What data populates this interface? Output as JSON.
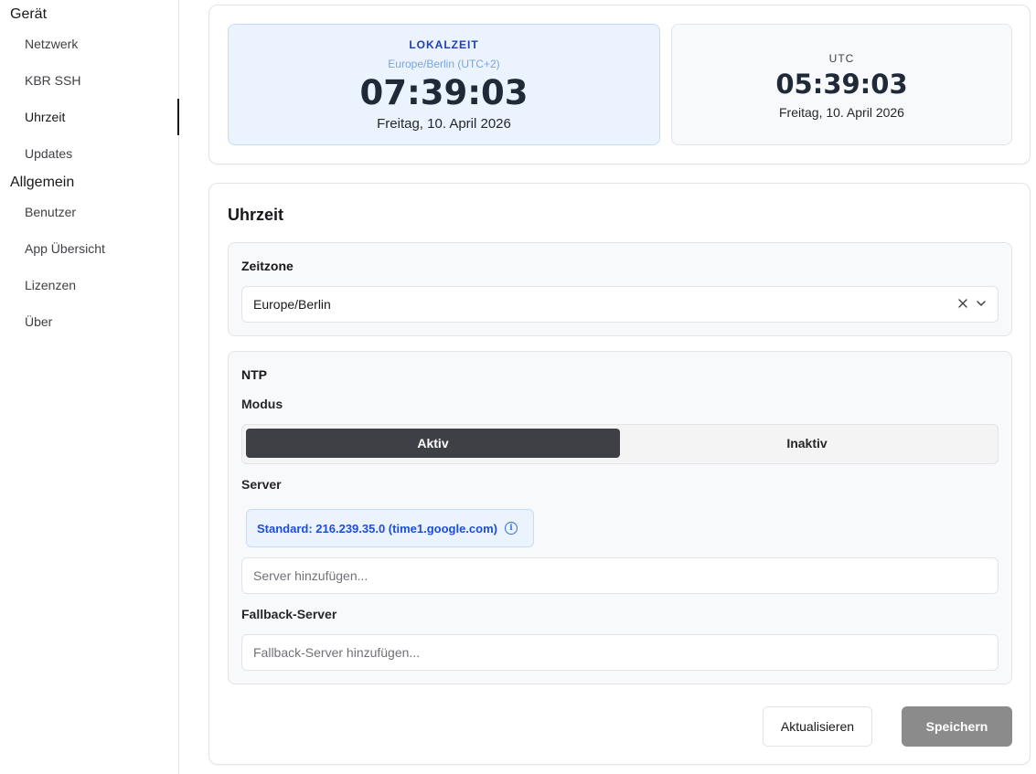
{
  "sidebar": {
    "groups": [
      {
        "title": "Gerät",
        "items": [
          {
            "label": "Netzwerk"
          },
          {
            "label": "KBR SSH"
          },
          {
            "label": "Uhrzeit"
          },
          {
            "label": "Updates"
          }
        ]
      },
      {
        "title": "Allgemein",
        "items": [
          {
            "label": "Benutzer"
          },
          {
            "label": "App Übersicht"
          },
          {
            "label": "Lizenzen"
          },
          {
            "label": "Über"
          }
        ]
      }
    ],
    "active_item": "Uhrzeit"
  },
  "clocks": {
    "local": {
      "label": "LOKALZEIT",
      "timezone": "Europe/Berlin (UTC+2)",
      "time": "07:39:03",
      "date": "Freitag, 10. April 2026"
    },
    "utc": {
      "label": "UTC",
      "time": "05:39:03",
      "date": "Freitag, 10. April 2026"
    }
  },
  "settings": {
    "title": "Uhrzeit",
    "timezone": {
      "label": "Zeitzone",
      "value": "Europe/Berlin",
      "clear_icon": "x-icon",
      "chevron_icon": "chevron-down-icon"
    },
    "ntp": {
      "title": "NTP",
      "mode_label": "Modus",
      "mode_options": [
        "Aktiv",
        "Inaktiv"
      ],
      "mode_selected": "Aktiv",
      "server_label": "Server",
      "default_server": "Standard: 216.239.35.0 (time1.google.com)",
      "default_server_icon": "info-icon",
      "server_placeholder": "Server hinzufügen...",
      "fallback_label": "Fallback-Server",
      "fallback_placeholder": "Fallback-Server hinzufügen..."
    },
    "buttons": {
      "refresh": "Aktualisieren",
      "save": "Speichern"
    }
  },
  "colors": {
    "accent_blue": "#1e40af",
    "local_clock_bg": "#eaf3fe",
    "active_segment": "#3f3f46",
    "save_button": "#8b8b8b"
  }
}
